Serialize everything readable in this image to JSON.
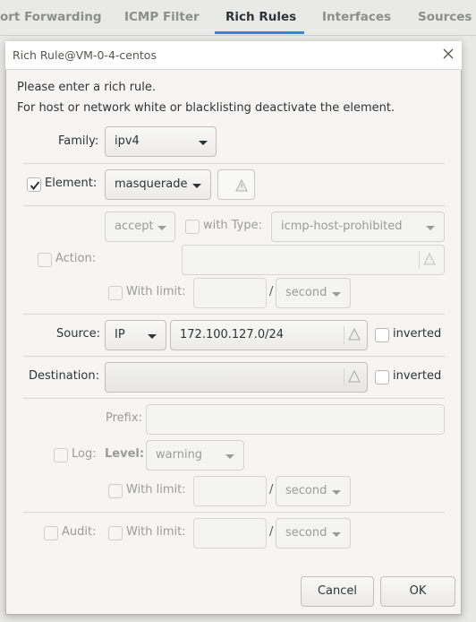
{
  "tabs": [
    {
      "label": "ort Forwarding"
    },
    {
      "label": "ICMP Filter"
    },
    {
      "label": "Rich Rules",
      "active": true
    },
    {
      "label": "Interfaces"
    },
    {
      "label": "Sources"
    }
  ],
  "dialog": {
    "title": "Rich Rule@VM-0-4-centos",
    "intro_line1": "Please enter a rich rule.",
    "intro_line2": "For host or network white or blacklisting deactivate the element."
  },
  "family": {
    "label": "Family:",
    "value": "ipv4"
  },
  "element": {
    "label": "Element:",
    "checked": true,
    "value": "masquerade"
  },
  "action": {
    "label": "Action:",
    "checked": false,
    "value": "accept",
    "with_type_label": "with Type:",
    "type_value": "icmp-host-prohibited",
    "with_limit_label": "With limit:",
    "limit_value": "",
    "separator": "/",
    "unit_value": "second"
  },
  "source": {
    "label": "Source:",
    "type_value": "IP",
    "address": "172.100.127.0/24",
    "inverted_label": "inverted"
  },
  "destination": {
    "label": "Destination:",
    "address": "",
    "inverted_label": "inverted"
  },
  "log": {
    "label": "Log:",
    "prefix_label": "Prefix:",
    "level_label": "Level:",
    "level_value": "warning",
    "with_limit_label": "With limit:",
    "separator": "/",
    "unit_value": "second"
  },
  "audit": {
    "label": "Audit:",
    "with_limit_label": "With limit:",
    "separator": "/",
    "unit_value": "second"
  },
  "buttons": {
    "cancel": "Cancel",
    "ok": "OK"
  },
  "colors": {
    "accent": "#3584e4",
    "check": "#2e3436"
  }
}
